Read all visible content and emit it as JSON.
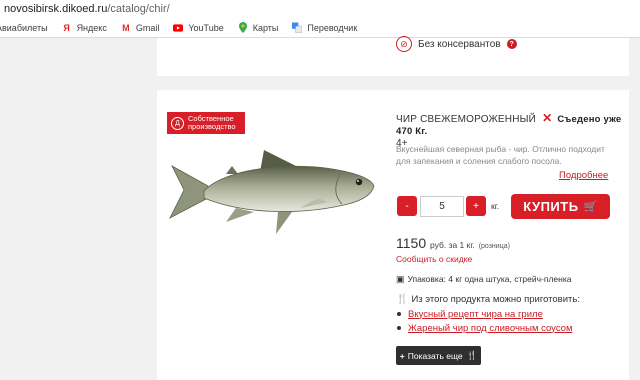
{
  "browser": {
    "url_host": "novosibirsk.dikoed.ru",
    "url_path": "/catalog/chir/",
    "bookmarks": [
      {
        "label": "Авиабилеты",
        "icon": "plane-icon"
      },
      {
        "label": "Яндекс",
        "icon": "yandex-icon"
      },
      {
        "label": "Gmail",
        "icon": "gmail-icon"
      },
      {
        "label": "YouTube",
        "icon": "youtube-icon"
      },
      {
        "label": "Карты",
        "icon": "maps-icon"
      },
      {
        "label": "Переводчик",
        "icon": "translate-icon"
      }
    ]
  },
  "prev_card": {
    "feature_label": "Без консервантов"
  },
  "product": {
    "badge": "Собственное производство",
    "badge_line1": "Собственное",
    "badge_line2": "производство",
    "title": "ЧИР СВЕЖЕМОРОЖЕННЫЙ 4+",
    "title_line1": "ЧИР СВЕЖЕМОРОЖЕННЫЙ",
    "title_line2": "4+",
    "eaten": "Съедено уже 470 Кг.",
    "description": "Вкуснейшая северная рыба - чир. Отлично подходит для запекания и соления слабого посола.",
    "more_link": "Подробнее",
    "qty_minus": "-",
    "qty_value": "5",
    "qty_plus": "+",
    "qty_unit": "кг.",
    "buy_label": "КУПИТЬ",
    "price": "1150",
    "price_unit": "руб. за 1 кг.",
    "price_note": "(розница)",
    "discount_link": "Сообщить о скидке",
    "packing": "Упаковка: 4 кг одна штука, стрейч-пленка",
    "cook_heading": "Из этого продукта можно приготовить:",
    "recipes": [
      "Вкусный рецепт чира на гриле",
      "Жареный чир под сливочным соусом"
    ],
    "show_more": "Показать еще"
  },
  "colors": {
    "accent": "#d81e26",
    "dark_button": "#2f2f2f",
    "page_bg": "#f1f1f1"
  }
}
